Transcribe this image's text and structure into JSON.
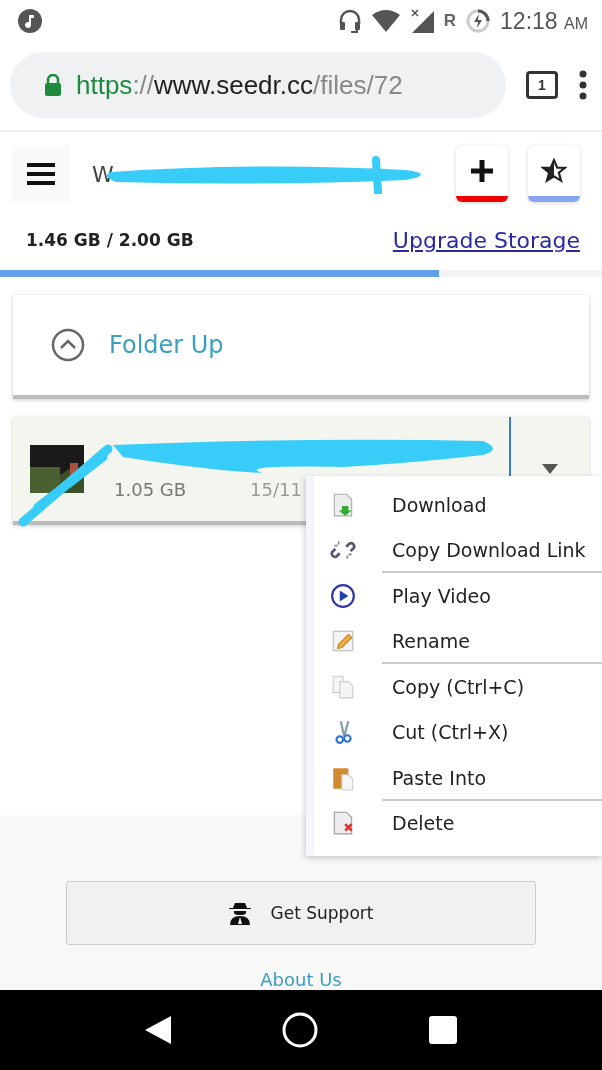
{
  "status_bar": {
    "time": "12:18",
    "meridiem": "AM",
    "signal_letter": "R"
  },
  "browser": {
    "url_scheme": "https",
    "url_sep": "://",
    "url_host": "www.seedr.cc",
    "url_path": "/files/72",
    "tab_count": "1"
  },
  "header": {
    "title": "W"
  },
  "storage": {
    "usage": "1.46 GB / 2.00 GB",
    "upgrade_link": "Upgrade Storage",
    "level": 0.73
  },
  "folder_up": {
    "label": "Folder Up"
  },
  "file": {
    "size": "1.05 GB",
    "date": "15/11"
  },
  "context_menu": [
    {
      "kind": "download",
      "label": "Download",
      "separator": false
    },
    {
      "kind": "link",
      "label": "Copy Download Link",
      "separator": true
    },
    {
      "kind": "play",
      "label": "Play Video",
      "separator": false
    },
    {
      "kind": "rename",
      "label": "Rename",
      "separator": true
    },
    {
      "kind": "copy",
      "label": "Copy (Ctrl+C)",
      "separator": false
    },
    {
      "kind": "cut",
      "label": "Cut (Ctrl+X)",
      "separator": false
    },
    {
      "kind": "paste",
      "label": "Paste Into",
      "separator": true
    },
    {
      "kind": "delete",
      "label": "Delete",
      "separator": false
    }
  ],
  "support_button": "Get Support",
  "footer_link": "About Us"
}
